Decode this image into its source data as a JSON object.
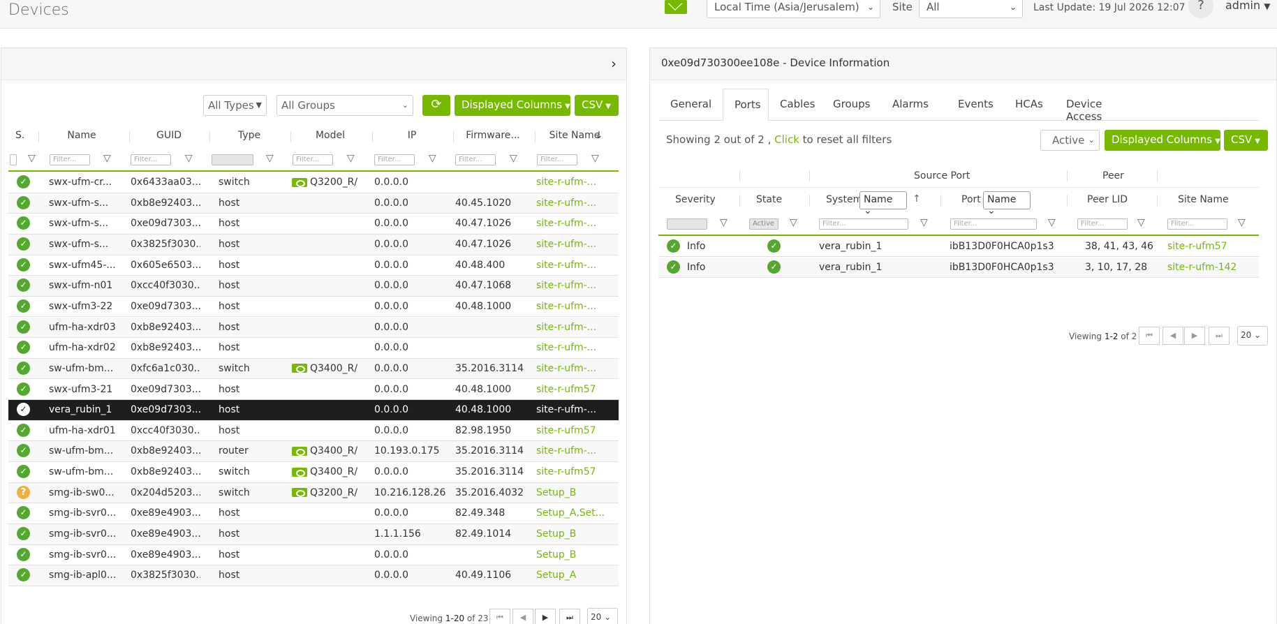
{
  "header": {
    "title": "Devices",
    "timezone": "Local Time (Asia/Jerusalem)",
    "site_label": "Site",
    "site_value": "All",
    "last_update": "Last Update: 19 Jul 2026 12:07",
    "help": "?",
    "user": "admin"
  },
  "left": {
    "types_select": "All Types",
    "groups_select": "All Groups",
    "displayed_columns": "Displayed Columns",
    "csv": "CSV",
    "columns": [
      "S.",
      "Name",
      "GUID",
      "Type",
      "Model",
      "IP",
      "Firmware...",
      "Site Name"
    ],
    "filter_placeholder": "Filter...",
    "rows": [
      {
        "status": "ok",
        "name": "swx-ufm-cr...",
        "guid": "0x6433aa03...",
        "type": "switch",
        "model": "Q3200_R/",
        "ip": "0.0.0.0",
        "fw": "",
        "site": "site-r-ufm-..."
      },
      {
        "status": "ok",
        "name": "swx-ufm-s...",
        "guid": "0xb8e92403...",
        "type": "host",
        "model": "",
        "ip": "0.0.0.0",
        "fw": "40.45.1020",
        "site": "site-r-ufm-..."
      },
      {
        "status": "ok",
        "name": "swx-ufm-s...",
        "guid": "0xe09d7303...",
        "type": "host",
        "model": "",
        "ip": "0.0.0.0",
        "fw": "40.47.1026",
        "site": "site-r-ufm-..."
      },
      {
        "status": "ok",
        "name": "swx-ufm-s...",
        "guid": "0x3825f3030...",
        "type": "host",
        "model": "",
        "ip": "0.0.0.0",
        "fw": "40.47.1026",
        "site": "site-r-ufm-..."
      },
      {
        "status": "ok",
        "name": "swx-ufm45-...",
        "guid": "0x605e6503...",
        "type": "host",
        "model": "",
        "ip": "0.0.0.0",
        "fw": "40.48.400",
        "site": "site-r-ufm-..."
      },
      {
        "status": "ok",
        "name": "swx-ufm-n01",
        "guid": "0xcc40f3030...",
        "type": "host",
        "model": "",
        "ip": "0.0.0.0",
        "fw": "40.47.1068",
        "site": "site-r-ufm-..."
      },
      {
        "status": "ok",
        "name": "swx-ufm3-22",
        "guid": "0xe09d7303...",
        "type": "host",
        "model": "",
        "ip": "0.0.0.0",
        "fw": "40.48.1000",
        "site": "site-r-ufm-..."
      },
      {
        "status": "ok",
        "name": "ufm-ha-xdr03",
        "guid": "0xb8e92403...",
        "type": "host",
        "model": "",
        "ip": "0.0.0.0",
        "fw": "",
        "site": "site-r-ufm-..."
      },
      {
        "status": "ok",
        "name": "ufm-ha-xdr02",
        "guid": "0xb8e92403...",
        "type": "host",
        "model": "",
        "ip": "0.0.0.0",
        "fw": "",
        "site": "site-r-ufm-..."
      },
      {
        "status": "ok",
        "name": "sw-ufm-bm...",
        "guid": "0xfc6a1c030...",
        "type": "switch",
        "model": "Q3400_R/",
        "ip": "0.0.0.0",
        "fw": "35.2016.3114",
        "site": "site-r-ufm-..."
      },
      {
        "status": "ok",
        "name": "swx-ufm3-21",
        "guid": "0xe09d7303...",
        "type": "host",
        "model": "",
        "ip": "0.0.0.0",
        "fw": "40.48.1000",
        "site": "site-r-ufm57"
      },
      {
        "status": "ok",
        "name": "vera_rubin_1",
        "guid": "0xe09d7303...",
        "type": "host",
        "model": "",
        "ip": "0.0.0.0",
        "fw": "40.48.1000",
        "site": "site-r-ufm-...",
        "selected": true
      },
      {
        "status": "ok",
        "name": "ufm-ha-xdr01",
        "guid": "0xcc40f3030...",
        "type": "host",
        "model": "",
        "ip": "0.0.0.0",
        "fw": "82.98.1950",
        "site": "site-r-ufm57"
      },
      {
        "status": "ok",
        "name": "sw-ufm-bm...",
        "guid": "0xb8e92403...",
        "type": "router",
        "model": "Q3400_R/",
        "ip": "10.193.0.175",
        "fw": "35.2016.3114",
        "site": "site-r-ufm-..."
      },
      {
        "status": "ok",
        "name": "sw-ufm-bm...",
        "guid": "0xb8e92403...",
        "type": "switch",
        "model": "Q3400_R/",
        "ip": "0.0.0.0",
        "fw": "35.2016.3114",
        "site": "site-r-ufm57"
      },
      {
        "status": "warn",
        "name": "smg-ib-sw0...",
        "guid": "0x204d5203...",
        "type": "switch",
        "model": "Q3200_R/",
        "ip": "10.216.128.26",
        "fw": "35.2016.4032",
        "site": "Setup_B"
      },
      {
        "status": "ok",
        "name": "smg-ib-svr0...",
        "guid": "0xe89e4903...",
        "type": "host",
        "model": "",
        "ip": "0.0.0.0",
        "fw": "82.49.348",
        "site": "Setup_A,Set..."
      },
      {
        "status": "ok",
        "name": "smg-ib-svr0...",
        "guid": "0xe89e4903...",
        "type": "host",
        "model": "",
        "ip": "1.1.1.156",
        "fw": "82.49.1014",
        "site": "Setup_B"
      },
      {
        "status": "ok",
        "name": "smg-ib-svr0...",
        "guid": "0xe89e4903...",
        "type": "host",
        "model": "",
        "ip": "0.0.0.0",
        "fw": "",
        "site": "Setup_B"
      },
      {
        "status": "ok",
        "name": "smg-ib-apl0...",
        "guid": "0x3825f3030...",
        "type": "host",
        "model": "",
        "ip": "0.0.0.0",
        "fw": "40.49.1106",
        "site": "Setup_A"
      }
    ],
    "pager": {
      "prefix": "Viewing ",
      "range": "1-20",
      "suffix": " of 23",
      "size": "20"
    }
  },
  "right": {
    "title": "0xe09d730300ee108e - Device Information",
    "tabs": [
      "General",
      "Ports",
      "Cables",
      "Groups",
      "Alarms",
      "Events",
      "HCAs",
      "Device Access"
    ],
    "active_tab": 1,
    "info_prefix": "Showing 2 out of 2 , ",
    "info_link": "Click",
    "info_suffix": " to reset all filters",
    "state_select": "Active",
    "displayed_columns": "Displayed Columns",
    "csv": "CSV",
    "group_headers": {
      "source_port": "Source Port",
      "peer": "Peer"
    },
    "columns": {
      "severity": "Severity",
      "state": "State",
      "system": "System",
      "system_sel": "Name",
      "port": "Port",
      "port_sel": "Name",
      "peer_lid": "Peer LID",
      "site_name": "Site Name"
    },
    "state_filter": "Active",
    "filter_placeholder": "Filter...",
    "rows": [
      {
        "severity": "Info",
        "system": "vera_rubin_1",
        "port": "ibB13D0F0HCA0p1s3",
        "lid": "38, 41, 43, 46",
        "site": "site-r-ufm57"
      },
      {
        "severity": "Info",
        "system": "vera_rubin_1",
        "port": "ibB13D0F0HCA0p1s3",
        "lid": "3, 10, 17, 28",
        "site": "site-r-ufm-142"
      }
    ],
    "pager": {
      "prefix": "Viewing ",
      "range": "1-2",
      "suffix": " of 2",
      "size": "20"
    }
  },
  "colors": {
    "accent": "#76b900",
    "selected_row": "#1e1e1e",
    "ok": "#54a830",
    "warn": "#f0b040"
  }
}
